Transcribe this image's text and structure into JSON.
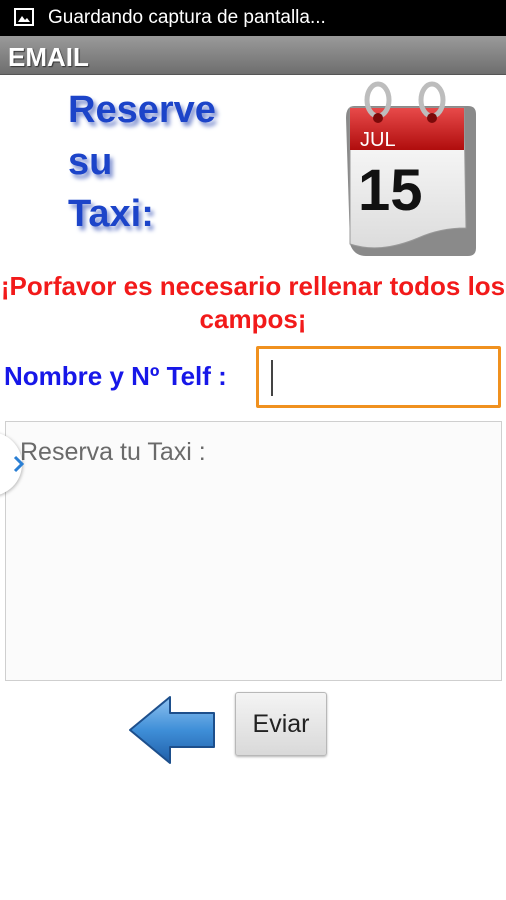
{
  "status_bar": {
    "text": "Guardando captura de pantalla...",
    "icon": "image-icon"
  },
  "title_bar": {
    "title": "EMAIL"
  },
  "header": {
    "title": "Reserve\nsu\nTaxi:",
    "calendar": {
      "month": "JUL",
      "day": "15",
      "icon": "calendar-icon"
    }
  },
  "form": {
    "warning": "¡Porfavor es necesario rellenar todos los campos¡",
    "name_label": "Nombre y Nº Telf :",
    "name_value": "",
    "message_placeholder": "Reserva tu Taxi :",
    "message_value": "",
    "send_label": "Eviar",
    "back_icon": "back-arrow-icon"
  },
  "colors": {
    "title_blue": "#1c44c9",
    "warning_red": "#f21a1a",
    "label_blue": "#1717e8",
    "focus_orange": "#f0911f"
  }
}
